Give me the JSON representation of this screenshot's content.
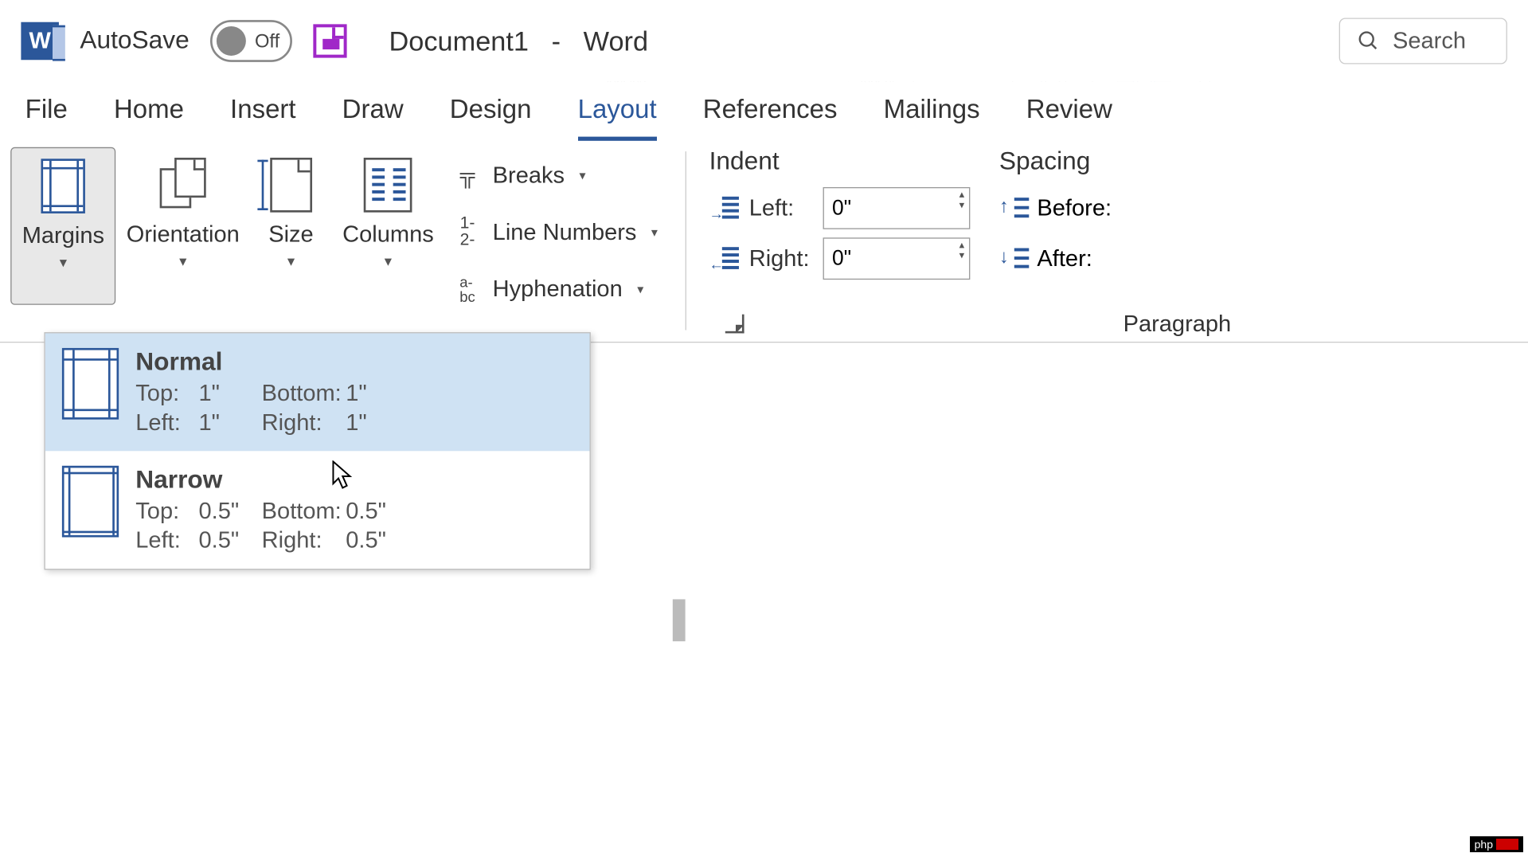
{
  "title": {
    "autosave_label": "AutoSave",
    "toggle_state": "Off",
    "document_name": "Document1",
    "app_sep": "-",
    "app_name": "Word",
    "search_placeholder": "Search"
  },
  "tabs": {
    "file": "File",
    "home": "Home",
    "insert": "Insert",
    "draw": "Draw",
    "design": "Design",
    "layout": "Layout",
    "references": "References",
    "mailings": "Mailings",
    "review": "Review"
  },
  "ribbon": {
    "margins": "Margins",
    "orientation": "Orientation",
    "size": "Size",
    "columns": "Columns",
    "breaks": "Breaks",
    "line_numbers": "Line Numbers",
    "hyphenation": "Hyphenation",
    "indent_title": "Indent",
    "indent_left_label": "Left:",
    "indent_left_value": "0\"",
    "indent_right_label": "Right:",
    "indent_right_value": "0\"",
    "spacing_title": "Spacing",
    "before_label": "Before:",
    "after_label": "After:",
    "paragraph_label": "Paragraph"
  },
  "margins_menu": {
    "items": [
      {
        "name": "Normal",
        "top_label": "Top:",
        "top_val": "1\"",
        "bottom_label": "Bottom:",
        "bottom_val": "1\"",
        "left_label": "Left:",
        "left_val": "1\"",
        "right_label": "Right:",
        "right_val": "1\""
      },
      {
        "name": "Narrow",
        "top_label": "Top:",
        "top_val": "0.5\"",
        "bottom_label": "Bottom:",
        "bottom_val": "0.5\"",
        "left_label": "Left:",
        "left_val": "0.5\"",
        "right_label": "Right:",
        "right_val": "0.5\""
      }
    ]
  },
  "watermark": "php"
}
